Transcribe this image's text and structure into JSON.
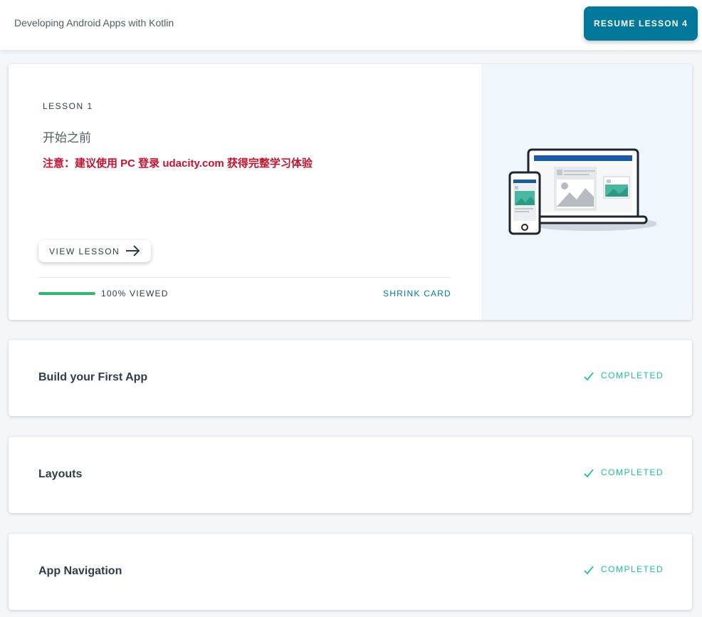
{
  "header": {
    "course_title": "Developing Android Apps with Kotlin",
    "resume_button_label": "RESUME LESSON 4"
  },
  "current_lesson": {
    "label": "LESSON 1",
    "title": "开始之前",
    "notice": "注意：建议使用 PC 登录 udacity.com 获得完整学习体验",
    "view_button_label": "VIEW LESSON",
    "progress_percent": 100,
    "progress_text": "100% VIEWED",
    "shrink_label": "SHRINK CARD",
    "illustration": "devices-illustration"
  },
  "lessons": [
    {
      "title": "Build your First App",
      "status": "COMPLETED"
    },
    {
      "title": "Layouts",
      "status": "COMPLETED"
    },
    {
      "title": "App Navigation",
      "status": "COMPLETED"
    }
  ],
  "colors": {
    "accent": "#02799a",
    "progress": "#2eb86b",
    "completed": "#15c39a",
    "notice": "#c8102e",
    "illustration_bg": "#eff6fc"
  },
  "icons": {
    "view_lesson": "arrow-right-icon",
    "completed": "checkmark-icon"
  }
}
